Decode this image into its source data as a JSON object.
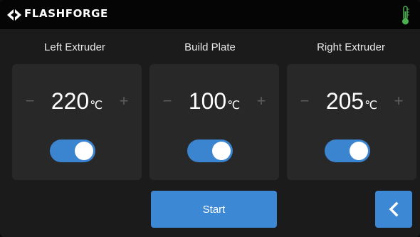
{
  "header": {
    "brand": "FLASHFORGE",
    "logo_icon": "flashforge-logo-icon",
    "status_icon": "thermometer-icon",
    "status_icon_color": "#4caf50"
  },
  "panels": [
    {
      "title": "Left Extruder",
      "temperature": "220",
      "unit": "℃",
      "decrease": "−",
      "increase": "+",
      "enabled": true
    },
    {
      "title": "Build Plate",
      "temperature": "100",
      "unit": "℃",
      "decrease": "−",
      "increase": "+",
      "enabled": true
    },
    {
      "title": "Right Extruder",
      "temperature": "205",
      "unit": "℃",
      "decrease": "−",
      "increase": "+",
      "enabled": true
    }
  ],
  "actions": {
    "start_label": "Start",
    "back_icon": "chevron-left-icon"
  },
  "colors": {
    "accent": "#3d88d4",
    "background": "#1b1b1c",
    "card": "#282829"
  }
}
